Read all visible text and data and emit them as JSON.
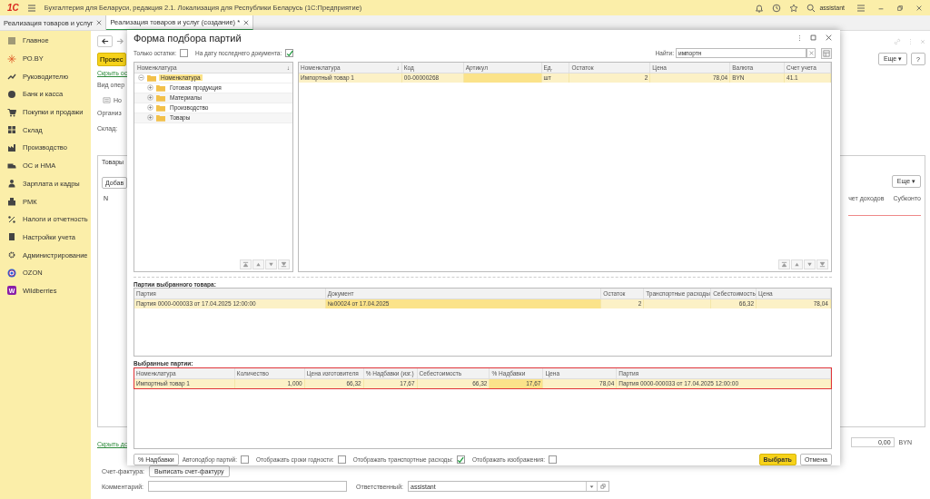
{
  "app_bar": {
    "logo": "1С",
    "title": "Бухгалтерия для Беларуси, редакция 2.1. Локализация для Республики Беларусь  (1С:Предприятие)",
    "user": "assistant"
  },
  "open_tabs": [
    {
      "label": "Реализация товаров и услуг",
      "selected": false
    },
    {
      "label": "Реализация товаров и услуг (создание) *",
      "selected": true
    }
  ],
  "sidebar": {
    "items": [
      {
        "label": "Главное"
      },
      {
        "label": "РО.BY"
      },
      {
        "label": "Руководителю"
      },
      {
        "label": "Банк и касса"
      },
      {
        "label": "Покупки и продажи"
      },
      {
        "label": "Склад"
      },
      {
        "label": "Производство"
      },
      {
        "label": "ОС и НМА"
      },
      {
        "label": "Зарплата и кадры"
      },
      {
        "label": "РМК"
      },
      {
        "label": "Налоги и отчетность"
      },
      {
        "label": "Настройки учета"
      },
      {
        "label": "Администрирование"
      },
      {
        "label": "OZON"
      },
      {
        "label": "Wildberries",
        "logo_letter": "W"
      }
    ]
  },
  "document": {
    "post_button": "Провес",
    "hide_link": "Скрыть ос",
    "operation_label": "Вид опер",
    "number_label": "Но",
    "organization_label": "Организ",
    "warehouse_label": "Склад:",
    "more_button": "Еще ▾",
    "help_button": "?",
    "products_tab": "Товары",
    "add_button": "Добав",
    "table_more_button": "Еще ▾",
    "column_n": "N",
    "right_columns": [
      "чет доходов",
      "Субконто"
    ],
    "hide_link_bottom": "Скрыть до",
    "total": "0,00",
    "currency": "BYN",
    "invoice_label": "Счет-фактура:",
    "invoice_button": "Выписать счет-фактуру",
    "comment_label": "Комментарий:",
    "responsible_label": "Ответственный:",
    "responsible_value": "assistant"
  },
  "dialog": {
    "title": "Форма подбора партий",
    "only_balances": {
      "label": "Только остатки:",
      "checked": false
    },
    "last_doc_date": {
      "label": "На дату последнего документа:",
      "checked": true
    },
    "search": {
      "label": "Найти:",
      "value": "импортн"
    },
    "tree": {
      "header": "Номенклатура",
      "sort": "↓",
      "items": [
        {
          "label": "Номенклатура",
          "selected": true,
          "expanded": true,
          "children": [
            {
              "label": "Готовая продукция",
              "selected": false,
              "expanded": false
            },
            {
              "label": "Материалы",
              "selected": false,
              "expanded": false
            },
            {
              "label": "Производство",
              "selected": false,
              "expanded": false
            },
            {
              "label": "Товары",
              "selected": false,
              "expanded": false
            }
          ]
        }
      ]
    },
    "products": {
      "columns": [
        {
          "label": "Номенклатура",
          "sort": "↓",
          "kind": "text"
        },
        {
          "label": "Код",
          "kind": "text"
        },
        {
          "label": "Артикул",
          "kind": "text"
        },
        {
          "label": "Ед.",
          "kind": "text"
        },
        {
          "label": "Остаток",
          "kind": "number"
        },
        {
          "label": "Цена",
          "kind": "number"
        },
        {
          "label": "Валюта",
          "kind": "text"
        },
        {
          "label": "Счет учета",
          "kind": "text"
        }
      ],
      "rows": [
        {
          "selected": true,
          "cells": [
            {
              "text": "Импортный товар 1",
              "active": false
            },
            {
              "text": "00-00000268",
              "active": false
            },
            {
              "active": true
            },
            {
              "text": "шт",
              "active": false
            },
            {
              "text": "2",
              "active": false
            },
            {
              "text": "78,04",
              "active": false
            },
            {
              "text": "BYN",
              "active": false
            },
            {
              "text": "41.1",
              "active": false
            }
          ]
        }
      ]
    },
    "batches": {
      "title": "Партии выбранного товара:",
      "highlighted": false,
      "columns": [
        {
          "label": "Партия",
          "kind": "text"
        },
        {
          "label": "Документ",
          "kind": "text"
        },
        {
          "label": "Остаток",
          "kind": "number"
        },
        {
          "label": "Транспортные расходы",
          "kind": "number"
        },
        {
          "label": "Себестоимость",
          "kind": "number"
        },
        {
          "label": "Цена",
          "kind": "number"
        }
      ],
      "rows": [
        {
          "selected": true,
          "cells": [
            {
              "text": "Партия 0000-000033 от 17.04.2025 12:00:00",
              "active": false
            },
            {
              "text": "№00024 от 17.04.2025",
              "active": true
            },
            {
              "text": "2",
              "active": false
            },
            {
              "active": false
            },
            {
              "text": "66,32",
              "active": false
            },
            {
              "text": "78,04",
              "active": false
            }
          ]
        }
      ]
    },
    "chosen": {
      "title": "Выбранные партии:",
      "highlighted": true,
      "columns": [
        {
          "label": "Номенклатура",
          "kind": "text"
        },
        {
          "label": "Количество",
          "kind": "number"
        },
        {
          "label": "Цена изготовителя",
          "kind": "number"
        },
        {
          "label": "% Надбавки (изг.)",
          "kind": "number"
        },
        {
          "label": "Себестоимость",
          "kind": "number"
        },
        {
          "label": "% Надбавки",
          "kind": "number"
        },
        {
          "label": "Цена",
          "kind": "number"
        },
        {
          "label": "Партия",
          "kind": "text"
        }
      ],
      "rows": [
        {
          "selected": true,
          "cells": [
            {
              "text": "Импортный товар 1",
              "active": false
            },
            {
              "text": "1,000",
              "active": false
            },
            {
              "text": "66,32",
              "active": false
            },
            {
              "text": "17,67",
              "active": false
            },
            {
              "text": "66,32",
              "active": false
            },
            {
              "text": "17,67",
              "active": true
            },
            {
              "text": "78,04",
              "active": false
            },
            {
              "text": "Партия 0000-000033 от 17.04.2025 12:00:00",
              "active": false
            }
          ]
        }
      ]
    },
    "footer": {
      "markup_button": "% Надбавки",
      "options": [
        {
          "label": "Автоподбор партий:",
          "checked": false
        },
        {
          "label": "Отображать сроки годности:",
          "checked": false
        },
        {
          "label": "Отображать транспортные расходы:",
          "checked": true
        },
        {
          "label": "Отображать изображения:",
          "checked": false
        }
      ],
      "select_button": "Выбрать",
      "cancel_button": "Отмена"
    }
  }
}
